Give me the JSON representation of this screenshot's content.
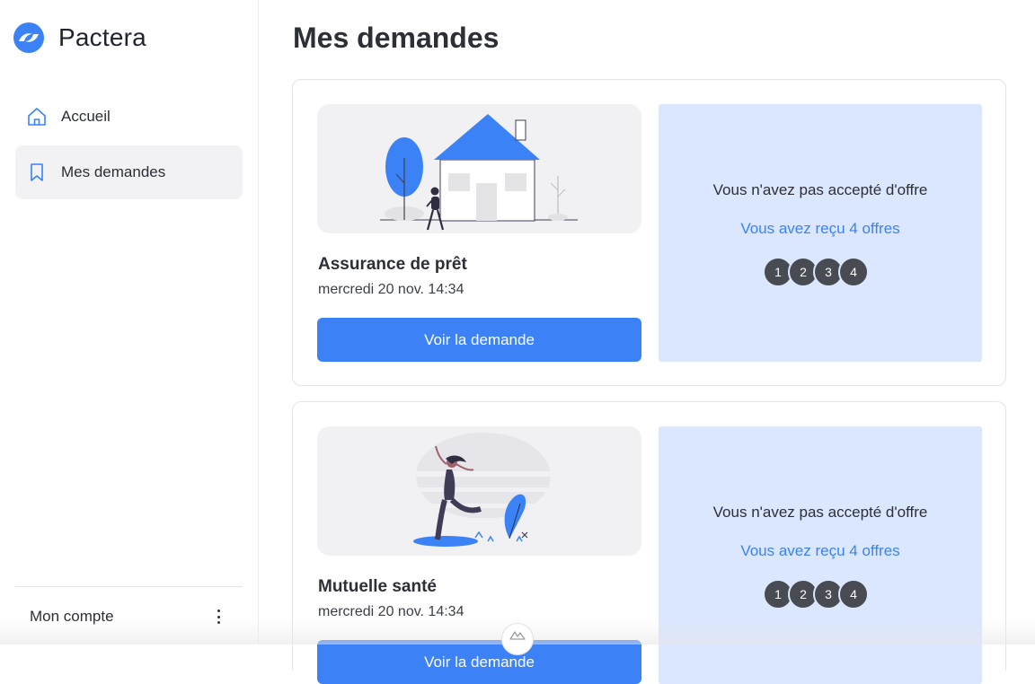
{
  "app": {
    "name": "Pactera"
  },
  "sidebar": {
    "items": [
      {
        "label": "Accueil",
        "icon": "home-icon",
        "active": false
      },
      {
        "label": "Mes demandes",
        "icon": "bookmark-icon",
        "active": true
      }
    ],
    "account_label": "Mon compte"
  },
  "page": {
    "title": "Mes demandes"
  },
  "requests": [
    {
      "title": "Assurance de prêt",
      "date": "mercredi 20 nov. 14:34",
      "button_label": "Voir la demande",
      "offer_status": "Vous n'avez pas accepté d'offre",
      "offer_count": "Vous avez reçu 4 offres",
      "offers": [
        "1",
        "2",
        "3",
        "4"
      ],
      "illustration": "house-illustration"
    },
    {
      "title": "Mutuelle santé",
      "date": "mercredi 20 nov. 14:34",
      "button_label": "Voir la demande",
      "offer_status": "Vous n'avez pas accepté d'offre",
      "offer_count": "Vous avez reçu 4 offres",
      "offers": [
        "1",
        "2",
        "3",
        "4"
      ],
      "illustration": "dancer-illustration"
    }
  ],
  "colors": {
    "primary": "#3c82f6",
    "panel": "#dbe7fe",
    "dot": "#494b52"
  }
}
